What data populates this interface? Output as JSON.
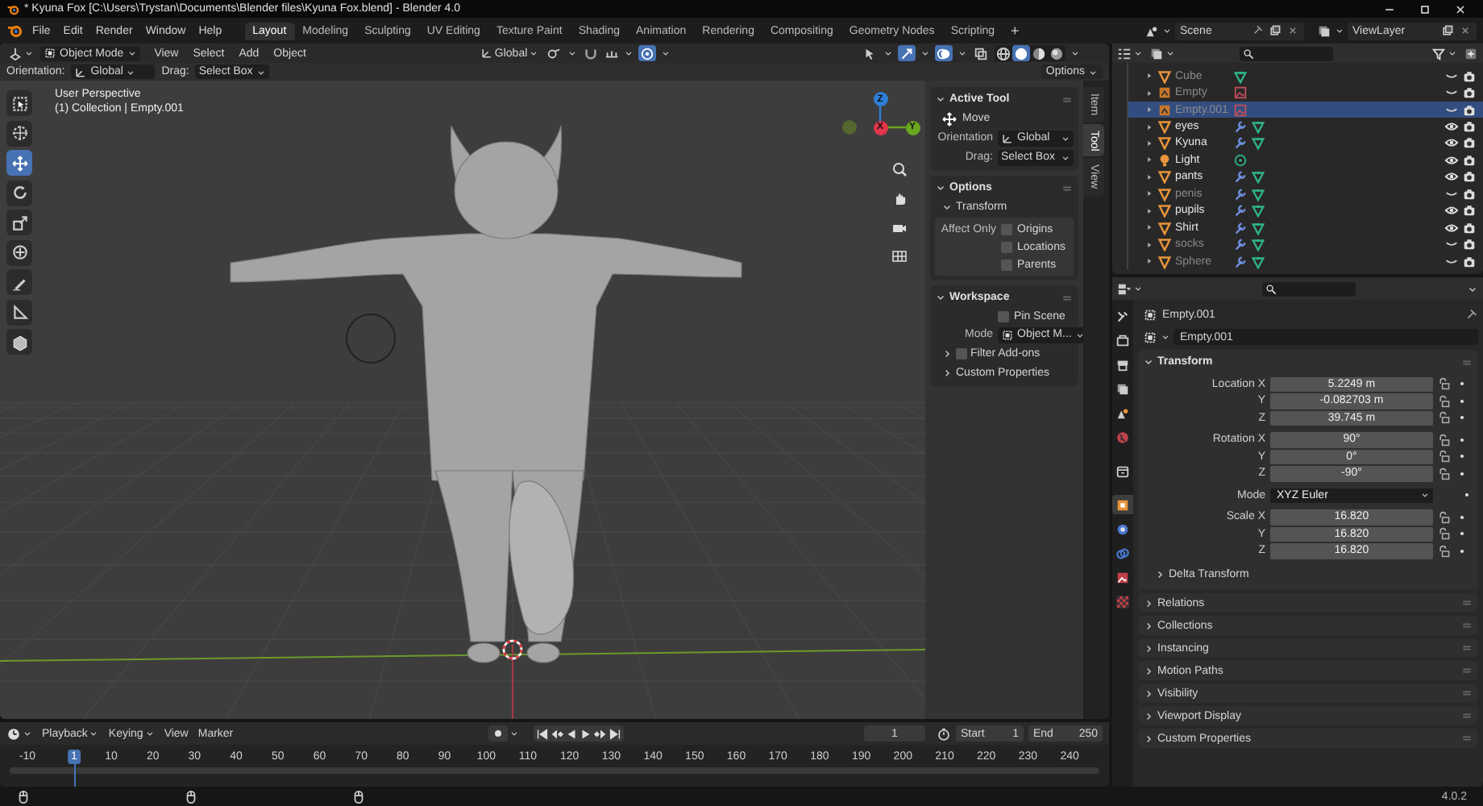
{
  "title_bar": {
    "title": "* Kyuna Fox [C:\\Users\\Trystan\\Documents\\Blender files\\Kyuna Fox.blend] - Blender 4.0"
  },
  "top_bar": {
    "menus": [
      "File",
      "Edit",
      "Render",
      "Window",
      "Help"
    ],
    "workspaces": [
      {
        "label": "Layout",
        "selected": true
      },
      {
        "label": "Modeling",
        "selected": false
      },
      {
        "label": "Sculpting",
        "selected": false
      },
      {
        "label": "UV Editing",
        "selected": false
      },
      {
        "label": "Texture Paint",
        "selected": false
      },
      {
        "label": "Shading",
        "selected": false
      },
      {
        "label": "Animation",
        "selected": false
      },
      {
        "label": "Rendering",
        "selected": false
      },
      {
        "label": "Compositing",
        "selected": false
      },
      {
        "label": "Geometry Nodes",
        "selected": false
      },
      {
        "label": "Scripting",
        "selected": false
      }
    ],
    "add_workspace": "+",
    "scene": "Scene",
    "view_layer": "ViewLayer"
  },
  "viewport": {
    "header": {
      "mode": "Object Mode",
      "menus": [
        "View",
        "Select",
        "Add",
        "Object"
      ],
      "orientation": "Global",
      "toggles": [
        {
          "kind": "pivot",
          "on": false
        },
        {
          "kind": "snap",
          "on": false
        },
        {
          "kind": "proportional",
          "on": true
        }
      ],
      "overlay_toggles": [
        {
          "kind": "selectability",
          "on": false
        },
        {
          "kind": "gizmos",
          "on": true
        },
        {
          "kind": "overlays",
          "on": true
        },
        {
          "kind": "xray",
          "on": false
        }
      ],
      "shading": [
        {
          "kind": "wireframe",
          "selected": false
        },
        {
          "kind": "solid",
          "selected": true
        },
        {
          "kind": "material",
          "selected": false
        },
        {
          "kind": "rendered",
          "selected": false
        }
      ]
    },
    "tool_settings": {
      "orientation_label": "Orientation:",
      "orientation": "Global",
      "drag_label": "Drag:",
      "drag": "Select Box",
      "options": "Options"
    },
    "info": [
      "User Perspective",
      "(1) Collection | Empty.001"
    ],
    "tools": [
      {
        "kind": "select_box",
        "selected": false
      },
      {
        "kind": "cursor",
        "selected": false
      },
      {
        "kind": "move",
        "selected": true
      },
      {
        "kind": "rotate",
        "selected": false
      },
      {
        "kind": "scale",
        "selected": false
      },
      {
        "kind": "transform",
        "selected": false
      },
      {
        "kind": "annotate",
        "selected": false
      },
      {
        "kind": "measure",
        "selected": false
      },
      {
        "kind": "add_cube",
        "selected": false
      }
    ],
    "gizmo_axes": [
      {
        "label": "Z",
        "color": "#2f7fd8"
      },
      {
        "label": "Y",
        "color": "#6aa61e"
      },
      {
        "label": "X",
        "color": "#e0354a"
      }
    ],
    "sidebar": {
      "tabs": [
        {
          "label": "Item",
          "selected": false
        },
        {
          "label": "Tool",
          "selected": true
        },
        {
          "label": "View",
          "selected": false
        }
      ],
      "active_tool": {
        "title": "Active Tool",
        "tool": "Move",
        "orientation_label": "Orientation",
        "orientation": "Global",
        "drag_label": "Drag:",
        "drag": "Select Box"
      },
      "options": {
        "title": "Options",
        "subpanel": "Transform",
        "affect_label": "Affect Only",
        "checks": [
          {
            "label": "Origins",
            "checked": false
          },
          {
            "label": "Locations",
            "checked": false
          },
          {
            "label": "Parents",
            "checked": false
          }
        ]
      },
      "workspace": {
        "title": "Workspace",
        "pin": {
          "label": "Pin Scene",
          "checked": false
        },
        "mode_label": "Mode",
        "mode": "Object M...",
        "subpanels": [
          {
            "label": "Filter Add-ons",
            "kind": "checkbox",
            "checked": false
          },
          {
            "label": "Custom Properties",
            "kind": "plain"
          }
        ]
      }
    }
  },
  "outliner": {
    "rows": [
      {
        "name": "Cube",
        "kind": "mesh",
        "modifier": false,
        "visible": false,
        "selected": false
      },
      {
        "name": "Empty",
        "kind": "empty",
        "modifier": false,
        "visible": false,
        "selected": false
      },
      {
        "name": "Empty.001",
        "kind": "empty",
        "modifier": false,
        "visible": false,
        "selected": true
      },
      {
        "name": "eyes",
        "kind": "mesh",
        "modifier": true,
        "visible": true,
        "selected": false
      },
      {
        "name": "Kyuna",
        "kind": "mesh",
        "modifier": true,
        "visible": true,
        "selected": false
      },
      {
        "name": "Light",
        "kind": "light",
        "modifier": false,
        "visible": true,
        "selected": false
      },
      {
        "name": "pants",
        "kind": "mesh",
        "modifier": true,
        "visible": true,
        "selected": false
      },
      {
        "name": "penis",
        "kind": "mesh",
        "modifier": true,
        "visible": false,
        "selected": false
      },
      {
        "name": "pupils",
        "kind": "mesh",
        "modifier": true,
        "visible": true,
        "selected": false
      },
      {
        "name": "Shirt",
        "kind": "mesh",
        "modifier": true,
        "visible": true,
        "selected": false
      },
      {
        "name": "socks",
        "kind": "mesh",
        "modifier": true,
        "visible": false,
        "selected": false
      },
      {
        "name": "Sphere",
        "kind": "mesh",
        "modifier": true,
        "visible": false,
        "selected": false
      }
    ]
  },
  "properties": {
    "tabs": [
      {
        "kind": "tool",
        "selected": false
      },
      {
        "kind": "render",
        "selected": false
      },
      {
        "kind": "output",
        "selected": false
      },
      {
        "kind": "view_layer",
        "selected": false
      },
      {
        "kind": "scene",
        "selected": false
      },
      {
        "kind": "world",
        "selected": false
      },
      {
        "kind": "collection",
        "selected": false
      },
      {
        "kind": "object",
        "selected": true
      },
      {
        "kind": "physics",
        "selected": false
      },
      {
        "kind": "constraints",
        "selected": false
      },
      {
        "kind": "data",
        "selected": false
      },
      {
        "kind": "texture",
        "selected": false
      }
    ],
    "object_name": "Empty.001",
    "data_name": "Empty.001",
    "transform": {
      "title": "Transform",
      "groups": [
        [
          {
            "label": "Location X",
            "value": "5.2249 m",
            "kind": "number"
          },
          {
            "label": "Y",
            "value": "-0.082703 m",
            "kind": "number"
          },
          {
            "label": "Z",
            "value": "39.745 m",
            "kind": "number"
          }
        ],
        [
          {
            "label": "Rotation X",
            "value": "90°",
            "kind": "number"
          },
          {
            "label": "Y",
            "value": "0°",
            "kind": "number"
          },
          {
            "label": "Z",
            "value": "-90°",
            "kind": "number"
          }
        ],
        [
          {
            "label": "Mode",
            "value": "XYZ Euler",
            "kind": "dropdown"
          }
        ],
        [
          {
            "label": "Scale X",
            "value": "16.820",
            "kind": "number"
          },
          {
            "label": "Y",
            "value": "16.820",
            "kind": "number"
          },
          {
            "label": "Z",
            "value": "16.820",
            "kind": "number"
          }
        ]
      ],
      "subpanel": "Delta Transform"
    },
    "panels": [
      "Relations",
      "Collections",
      "Instancing",
      "Motion Paths",
      "Visibility",
      "Viewport Display",
      "Custom Properties"
    ]
  },
  "timeline": {
    "menus": [
      "Playback",
      "Keying",
      "View",
      "Marker"
    ],
    "current_frame": "1",
    "start_label": "Start",
    "start": "1",
    "end_label": "End",
    "end": "250",
    "ruler": [
      {
        "label": "-10",
        "selected": false
      },
      {
        "label": "1",
        "selected": true
      },
      {
        "label": "10",
        "selected": false
      },
      {
        "label": "20",
        "selected": false
      },
      {
        "label": "30",
        "selected": false
      },
      {
        "label": "40",
        "selected": false
      },
      {
        "label": "50",
        "selected": false
      },
      {
        "label": "60",
        "selected": false
      },
      {
        "label": "70",
        "selected": false
      },
      {
        "label": "80",
        "selected": false
      },
      {
        "label": "90",
        "selected": false
      },
      {
        "label": "100",
        "selected": false
      },
      {
        "label": "110",
        "selected": false
      },
      {
        "label": "120",
        "selected": false
      },
      {
        "label": "130",
        "selected": false
      },
      {
        "label": "140",
        "selected": false
      },
      {
        "label": "150",
        "selected": false
      },
      {
        "label": "160",
        "selected": false
      },
      {
        "label": "170",
        "selected": false
      },
      {
        "label": "180",
        "selected": false
      },
      {
        "label": "190",
        "selected": false
      },
      {
        "label": "200",
        "selected": false
      },
      {
        "label": "210",
        "selected": false
      },
      {
        "label": "220",
        "selected": false
      },
      {
        "label": "230",
        "selected": false
      },
      {
        "label": "240",
        "selected": false
      }
    ]
  },
  "status_bar": {
    "version": "4.0.2"
  }
}
